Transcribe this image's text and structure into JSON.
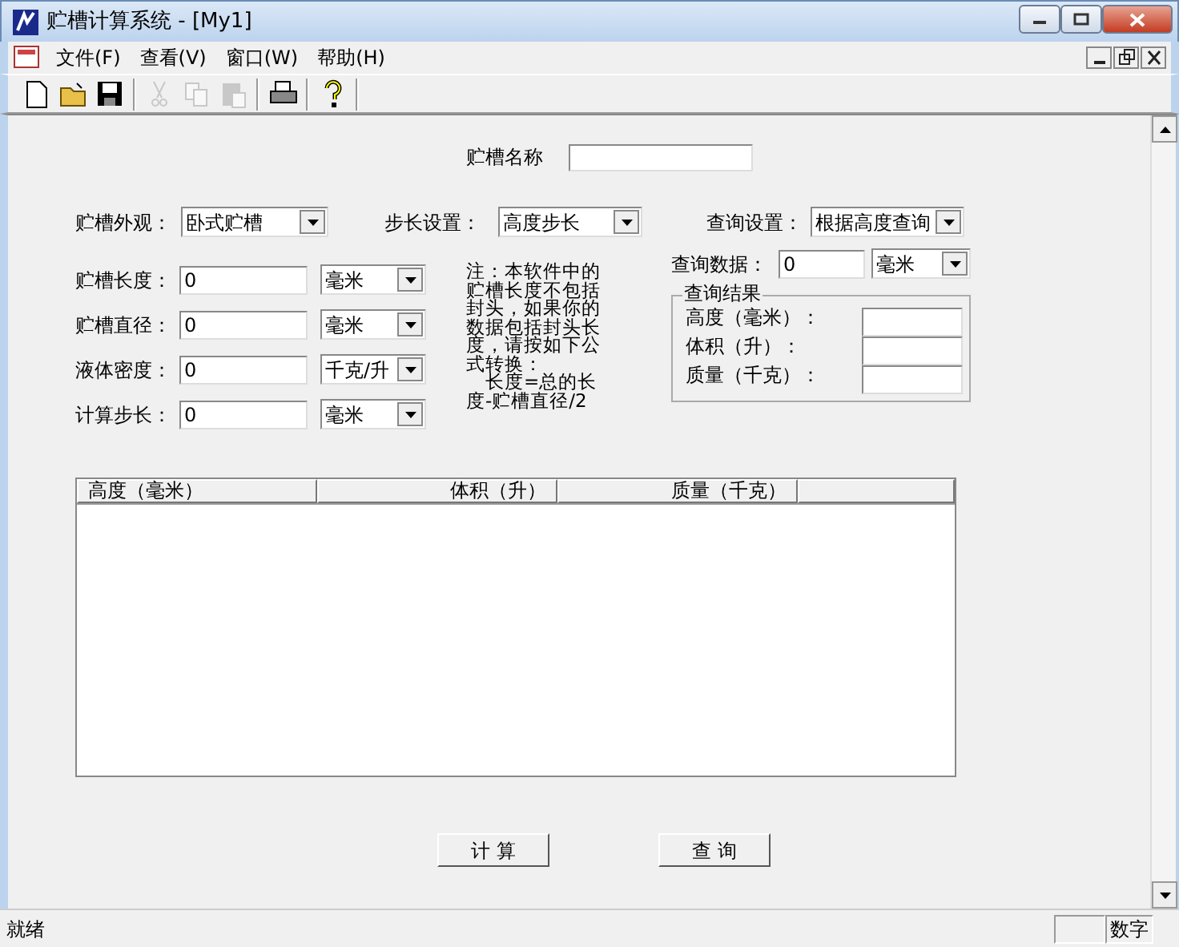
{
  "window": {
    "title": "贮槽计算系统 - [My1]"
  },
  "menu": [
    {
      "label": "文件(F)"
    },
    {
      "label": "查看(V)"
    },
    {
      "label": "窗口(W)"
    },
    {
      "label": "帮助(H)"
    }
  ],
  "toolbar": [
    {
      "kind": "new",
      "disabled": false
    },
    {
      "kind": "open",
      "disabled": false
    },
    {
      "kind": "save",
      "disabled": false
    },
    {
      "kind": "cut",
      "disabled": true
    },
    {
      "kind": "copy",
      "disabled": true
    },
    {
      "kind": "paste",
      "disabled": true
    },
    {
      "kind": "print",
      "disabled": false
    },
    {
      "kind": "help",
      "disabled": false
    }
  ],
  "name_field": {
    "label": "贮槽名称"
  },
  "selectors": [
    {
      "label": "贮槽外观：",
      "value": "卧式贮槽"
    },
    {
      "label": "步长设置：",
      "value": "高度步长"
    },
    {
      "label": "查询设置：",
      "value": "根据高度查询"
    }
  ],
  "inputs": [
    {
      "label": "贮槽长度：",
      "value": "0",
      "unit": "毫米"
    },
    {
      "label": "贮槽直径：",
      "value": "0",
      "unit": "毫米"
    },
    {
      "label": "液体密度：",
      "value": "0",
      "unit": "千克/升"
    },
    {
      "label": "计算步长：",
      "value": "0",
      "unit": "毫米"
    }
  ],
  "note": [
    "注：本软件中的贮槽长度不包括封头，如果你的数据包括封头长度，请按如下公式转换：",
    "长度=总的长度-贮槽直径/2"
  ],
  "query": {
    "label": "查询数据：",
    "value": "0",
    "unit": "毫米"
  },
  "results": {
    "title": "查询结果",
    "fields": [
      {
        "label": "高度（毫米）："
      },
      {
        "label": "体积（升）："
      },
      {
        "label": "质量（千克）："
      }
    ]
  },
  "table": {
    "columns": [
      "高度（毫米）",
      "体积（升）",
      "质量（千克）"
    ]
  },
  "buttons": [
    "计 算",
    "查 询"
  ],
  "status_bar": {
    "message": "就绪",
    "indicator": "数字"
  }
}
